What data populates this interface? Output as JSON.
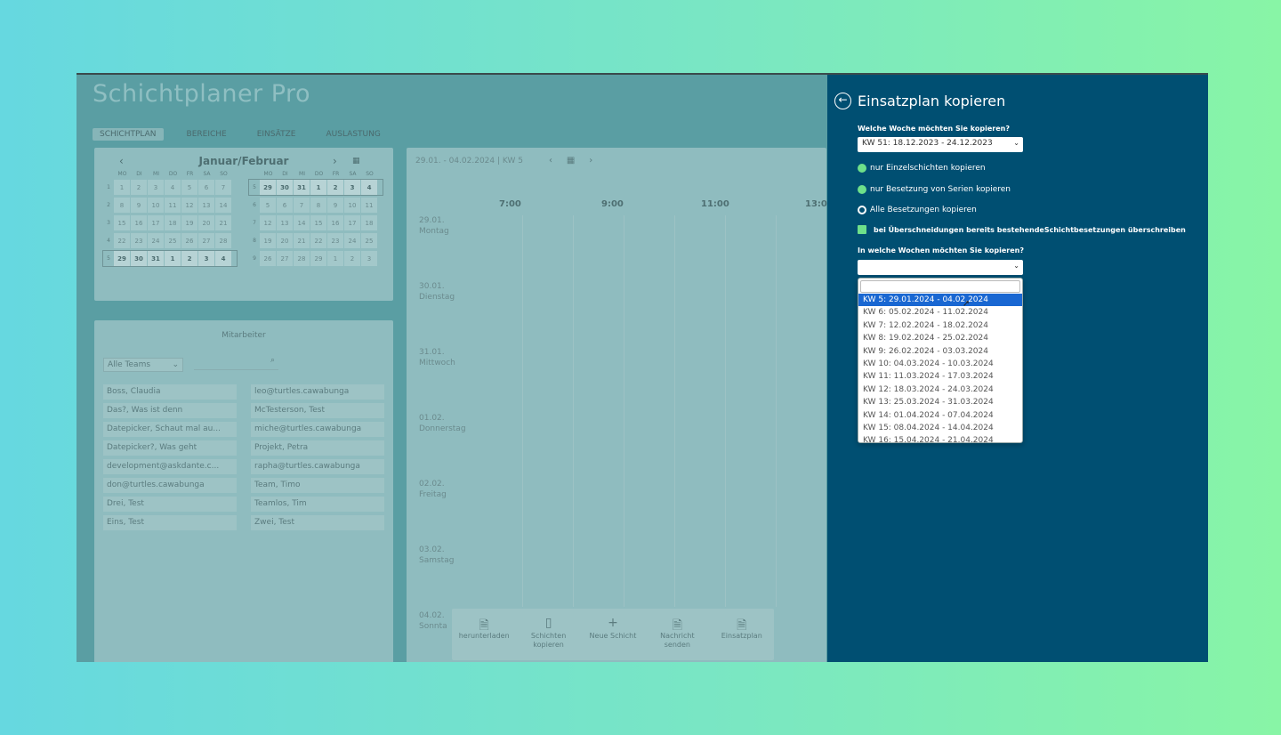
{
  "app": {
    "title": "Schichtplaner Pro",
    "nav": [
      "SCHICHTPLAN",
      "BEREICHE",
      "EINSÄTZE",
      "AUSLASTUNG"
    ]
  },
  "calendar": {
    "title": "Januar/Februar",
    "prev": "‹",
    "next": "›",
    "dow": [
      "MO",
      "DI",
      "MI",
      "DO",
      "FR",
      "SA",
      "SO"
    ],
    "january": [
      {
        "wn": "1",
        "days": [
          "1",
          "2",
          "3",
          "4",
          "5",
          "6",
          "7"
        ]
      },
      {
        "wn": "2",
        "days": [
          "8",
          "9",
          "10",
          "11",
          "12",
          "13",
          "14"
        ]
      },
      {
        "wn": "3",
        "days": [
          "15",
          "16",
          "17",
          "18",
          "19",
          "20",
          "21"
        ]
      },
      {
        "wn": "4",
        "days": [
          "22",
          "23",
          "24",
          "25",
          "26",
          "27",
          "28"
        ]
      },
      {
        "wn": "5",
        "days": [
          "29",
          "30",
          "31",
          "1",
          "2",
          "3",
          "4"
        ]
      }
    ],
    "february": [
      {
        "wn": "5",
        "days": [
          "29",
          "30",
          "31",
          "1",
          "2",
          "3",
          "4"
        ]
      },
      {
        "wn": "6",
        "days": [
          "5",
          "6",
          "7",
          "8",
          "9",
          "10",
          "11"
        ]
      },
      {
        "wn": "7",
        "days": [
          "12",
          "13",
          "14",
          "15",
          "16",
          "17",
          "18"
        ]
      },
      {
        "wn": "8",
        "days": [
          "19",
          "20",
          "21",
          "22",
          "23",
          "24",
          "25"
        ]
      },
      {
        "wn": "9",
        "days": [
          "26",
          "27",
          "28",
          "29",
          "1",
          "2",
          "3"
        ]
      }
    ]
  },
  "employees": {
    "title": "Mitarbeiter",
    "team_filter": "Alle Teams",
    "list": [
      "Boss, Claudia",
      "leo@turtles.cawabunga",
      "Das?, Was ist denn",
      "McTesterson, Test",
      "Datepicker, Schaut mal au...",
      "miche@turtles.cawabunga",
      "Datepicker?, Was geht",
      "Projekt, Petra",
      "development@askdante.c...",
      "rapha@turtles.cawabunga",
      "don@turtles.cawabunga",
      "Team, Timo",
      "Drei, Test",
      "Teamlos, Tim",
      "Eins, Test",
      "Zwei, Test"
    ]
  },
  "plan": {
    "range": "29.01. - 04.02.2024 | KW 5",
    "hours": [
      "7:00",
      "9:00",
      "11:00",
      "13:0"
    ],
    "days": [
      {
        "date": "29.01.",
        "name": "Montag"
      },
      {
        "date": "30.01.",
        "name": "Dienstag"
      },
      {
        "date": "31.01.",
        "name": "Mittwoch"
      },
      {
        "date": "01.02.",
        "name": "Donnerstag"
      },
      {
        "date": "02.02.",
        "name": "Freitag"
      },
      {
        "date": "03.02.",
        "name": "Samstag"
      },
      {
        "date": "04.02.",
        "name": "Sonnta"
      }
    ],
    "toolbar": [
      {
        "icon": "🗎",
        "label": "herunterladen"
      },
      {
        "icon": "▯",
        "label": "Schichten kopieren"
      },
      {
        "icon": "+",
        "label": "Neue Schicht"
      },
      {
        "icon": "🗎",
        "label": "Nachricht senden"
      },
      {
        "icon": "🗎",
        "label": "Einsatzplan"
      }
    ]
  },
  "dialog": {
    "back": "←",
    "title": "Einsatzplan kopieren",
    "source_question": "Welche Woche möchten Sie kopieren?",
    "source_week": "KW 51: 18.12.2023 - 24.12.2023",
    "options": [
      "nur Einzelschichten kopieren",
      "nur Besetzung von Serien kopieren",
      "Alle Besetzungen kopieren"
    ],
    "overwrite_label": "bei Überschneidungen bereits bestehendeSchichtbesetzungen überschreiben",
    "target_question": "In welche Wochen möchten Sie kopieren?",
    "target_weeks": [
      "KW 5: 29.01.2024 - 04.02.2024",
      "KW 6: 05.02.2024 - 11.02.2024",
      "KW 7: 12.02.2024 - 18.02.2024",
      "KW 8: 19.02.2024 - 25.02.2024",
      "KW 9: 26.02.2024 - 03.03.2024",
      "KW 10: 04.03.2024 - 10.03.2024",
      "KW 11: 11.03.2024 - 17.03.2024",
      "KW 12: 18.03.2024 - 24.03.2024",
      "KW 13: 25.03.2024 - 31.03.2024",
      "KW 14: 01.04.2024 - 07.04.2024",
      "KW 15: 08.04.2024 - 14.04.2024",
      "KW 16: 15.04.2024 - 21.04.2024"
    ]
  }
}
